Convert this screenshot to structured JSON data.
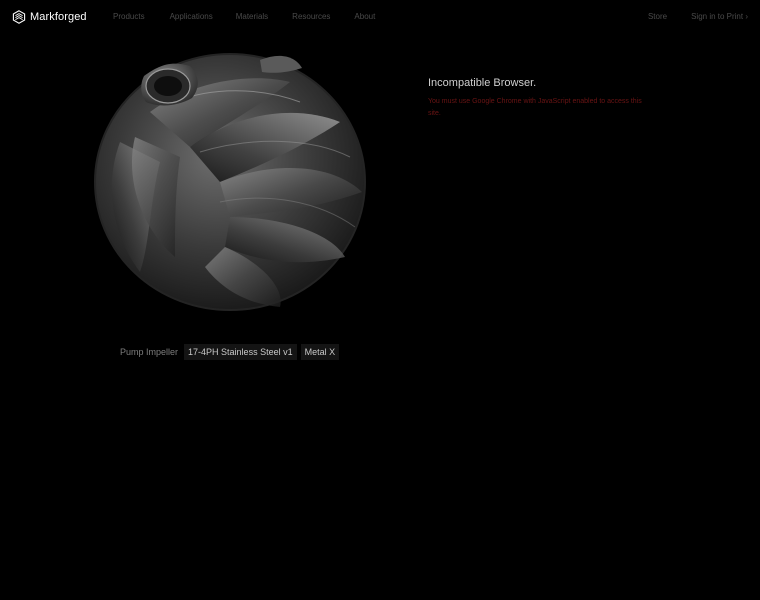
{
  "brand": {
    "name": "Markforged"
  },
  "nav": {
    "links": [
      {
        "label": "Products"
      },
      {
        "label": "Applications"
      },
      {
        "label": "Materials"
      },
      {
        "label": "Resources"
      },
      {
        "label": "About"
      }
    ],
    "store": "Store",
    "sign_in": "Sign in to Print ›"
  },
  "hero": {
    "image_subject": "pump-impeller-render",
    "caption_label": "Pump Impeller",
    "tags": [
      "17-4PH Stainless Steel v1",
      "Metal X"
    ]
  },
  "notice": {
    "title": "Incompatible Browser.",
    "message": "You must use Google Chrome with JavaScript enabled to access this site."
  },
  "colors": {
    "background": "#000000",
    "nav_text": "#4a4a4a",
    "error_text": "#6a1414",
    "tag_bg": "#141414"
  }
}
